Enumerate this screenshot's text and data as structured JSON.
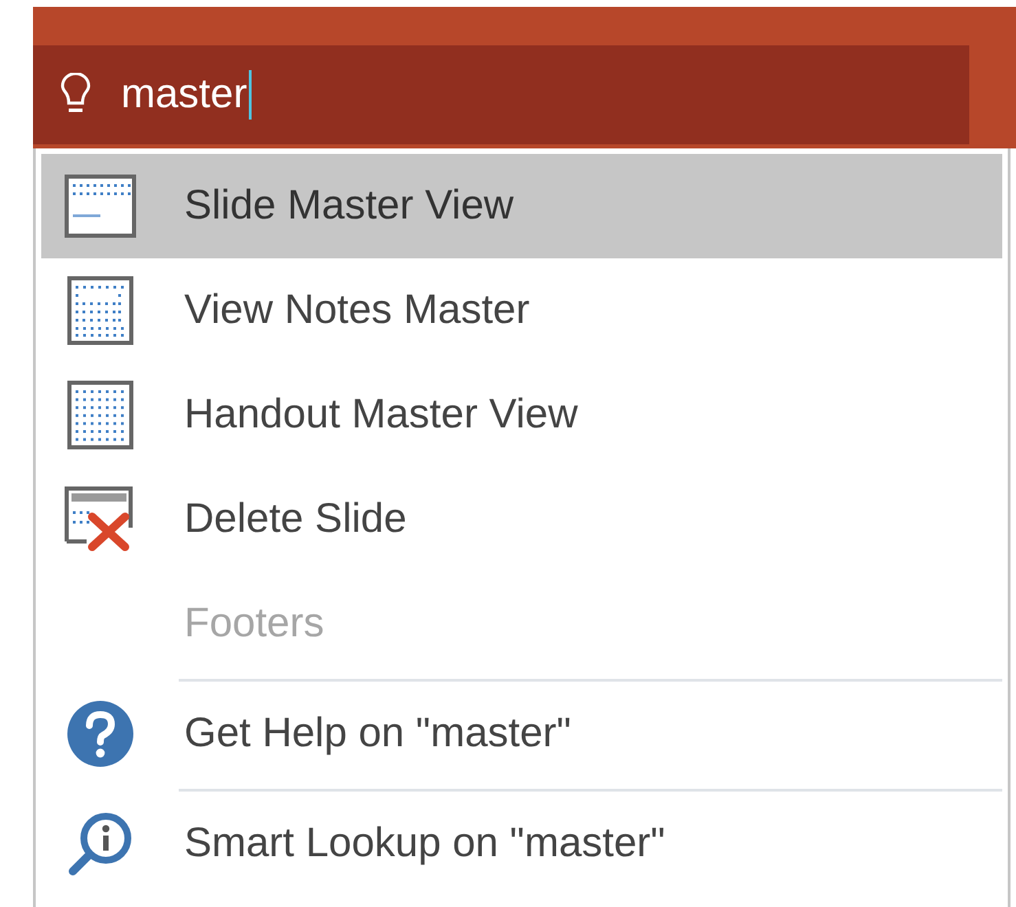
{
  "search": {
    "value": "master"
  },
  "menu": {
    "items": [
      {
        "label": "Slide Master View",
        "kind": "master",
        "selected": true,
        "disabled": false,
        "separator_before": false
      },
      {
        "label": "View Notes Master",
        "kind": "notes",
        "selected": false,
        "disabled": false,
        "separator_before": false
      },
      {
        "label": "Handout Master View",
        "kind": "handout",
        "selected": false,
        "disabled": false,
        "separator_before": false
      },
      {
        "label": "Delete Slide",
        "kind": "delete",
        "selected": false,
        "disabled": false,
        "separator_before": false
      },
      {
        "label": "Footers",
        "kind": "plain",
        "selected": false,
        "disabled": true,
        "separator_before": false
      },
      {
        "label": "Get Help on \"master\"",
        "kind": "help",
        "selected": false,
        "disabled": false,
        "separator_before": true
      },
      {
        "label": "Smart Lookup on \"master\"",
        "kind": "lookup",
        "selected": false,
        "disabled": false,
        "separator_before": true
      }
    ]
  }
}
